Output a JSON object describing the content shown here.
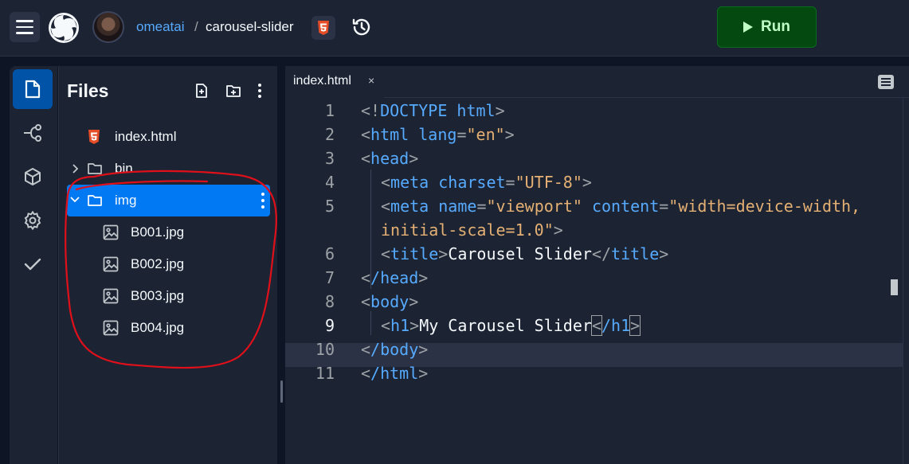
{
  "topbar": {
    "username": "omeatai",
    "separator": "/",
    "repl_name": "carousel-slider",
    "run_label": "Run",
    "html_badge_icon": "html5-icon",
    "history_icon": "history-icon",
    "menu_icon": "hamburger-menu-icon",
    "logo_icon": "replit-logo-icon"
  },
  "rail": {
    "items": [
      {
        "icon": "files-icon",
        "active": true
      },
      {
        "icon": "git-icon",
        "active": false
      },
      {
        "icon": "packages-icon",
        "active": false
      },
      {
        "icon": "settings-icon",
        "active": false
      },
      {
        "icon": "check-icon",
        "active": false
      }
    ]
  },
  "files": {
    "title": "Files",
    "tree": [
      {
        "name": "index.html",
        "type": "html-file"
      },
      {
        "name": "bin",
        "type": "folder",
        "expanded": false
      },
      {
        "name": "img",
        "type": "folder",
        "expanded": true,
        "selected": true
      },
      {
        "name": "B001.jpg",
        "type": "image"
      },
      {
        "name": "B002.jpg",
        "type": "image"
      },
      {
        "name": "B003.jpg",
        "type": "image"
      },
      {
        "name": "B004.jpg",
        "type": "image"
      }
    ]
  },
  "editor": {
    "tab_label": "index.html",
    "tab_close": "×",
    "current_line": "9",
    "line_numbers": [
      "1",
      "2",
      "3",
      "4",
      "5",
      "",
      "6",
      "7",
      "8",
      "9",
      "10",
      "11"
    ],
    "lines": {
      "l1_open": "<!",
      "l1_doctype": "DOCTYPE",
      "l1_html": " html",
      "l1_close": ">",
      "l2_open": "<",
      "l2_tag": "html",
      "l2_attr": " lang",
      "l2_eq": "=",
      "l2_val": "\"en\"",
      "l2_close": ">",
      "l3": "head",
      "l4_tag": "meta",
      "l4_attr": " charset",
      "l4_val": "\"UTF-8\"",
      "l5_tag": "meta",
      "l5_attr1": " name",
      "l5_val1": "\"viewport\"",
      "l5_attr2": " content",
      "l5_val2a": "\"width=device-width,",
      "l5_val2b": "initial-scale=1.0\"",
      "l6_tag": "title",
      "l6_text": "Carousel Slider",
      "l7": "/head",
      "l8": "body",
      "l9_tag": "h1",
      "l9_text": "My Carousel Slider",
      "l9_close": "/h1",
      "l10": "/body",
      "l11": "/html"
    }
  },
  "colors": {
    "accent_blue": "#0079f2",
    "link_blue": "#57abff",
    "run_green": "#044a10",
    "string_orange": "#e5b073",
    "annotation_red": "#e0101a"
  }
}
